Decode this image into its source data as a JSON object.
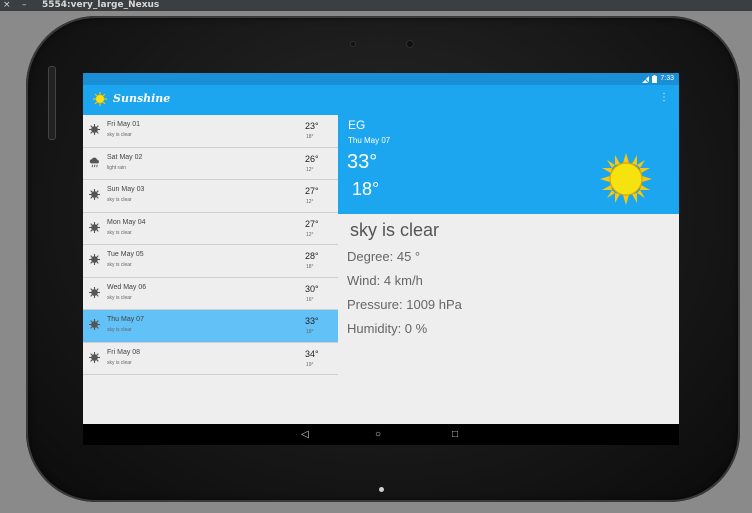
{
  "window": {
    "title": "5554:very_large_Nexus",
    "close_glyph": "×",
    "minimize_glyph": "–"
  },
  "status_bar": {
    "time": "7:33",
    "icons": [
      "signal-icon",
      "battery-icon"
    ]
  },
  "app_bar": {
    "title": "Sunshine",
    "overflow_glyph": "⋮"
  },
  "forecast": [
    {
      "day": "Fri May 01",
      "desc": "sky is clear",
      "high": "23°",
      "low": "18°",
      "icon": "sun-small-icon",
      "selected": false
    },
    {
      "day": "Sat May 02",
      "desc": "light rain",
      "high": "26°",
      "low": "12°",
      "icon": "rain-icon",
      "selected": false
    },
    {
      "day": "Sun May 03",
      "desc": "sky is clear",
      "high": "27°",
      "low": "12°",
      "icon": "sun-small-icon",
      "selected": false
    },
    {
      "day": "Mon May 04",
      "desc": "sky is clear",
      "high": "27°",
      "low": "12°",
      "icon": "sun-small-icon",
      "selected": false
    },
    {
      "day": "Tue May 05",
      "desc": "sky is clear",
      "high": "28°",
      "low": "18°",
      "icon": "sun-small-icon",
      "selected": false
    },
    {
      "day": "Wed May 06",
      "desc": "sky is clear",
      "high": "30°",
      "low": "16°",
      "icon": "sun-small-icon",
      "selected": false
    },
    {
      "day": "Thu May 07",
      "desc": "sky is clear",
      "high": "33°",
      "low": "18°",
      "icon": "sun-small-icon",
      "selected": true
    },
    {
      "day": "Fri May 08",
      "desc": "sky is clear",
      "high": "34°",
      "low": "19°",
      "icon": "sun-small-icon",
      "selected": false
    }
  ],
  "detail": {
    "city": "EG",
    "date": "Thu May 07",
    "high": "33°",
    "low": "18°",
    "condition": "sky is clear",
    "degree": "Degree: 45 °",
    "wind": "Wind: 4 km/h",
    "pressure": "Pressure: 1009 hPa",
    "humidity": "Humidity: 0 %"
  },
  "nav": {
    "back_glyph": "◁",
    "home_glyph": "○",
    "recent_glyph": "□"
  },
  "colors": {
    "primary": "#1ca6ef",
    "primary_dark": "#1a8fd6",
    "selected_row": "#62c1f7",
    "sun": "#f6e20e"
  }
}
